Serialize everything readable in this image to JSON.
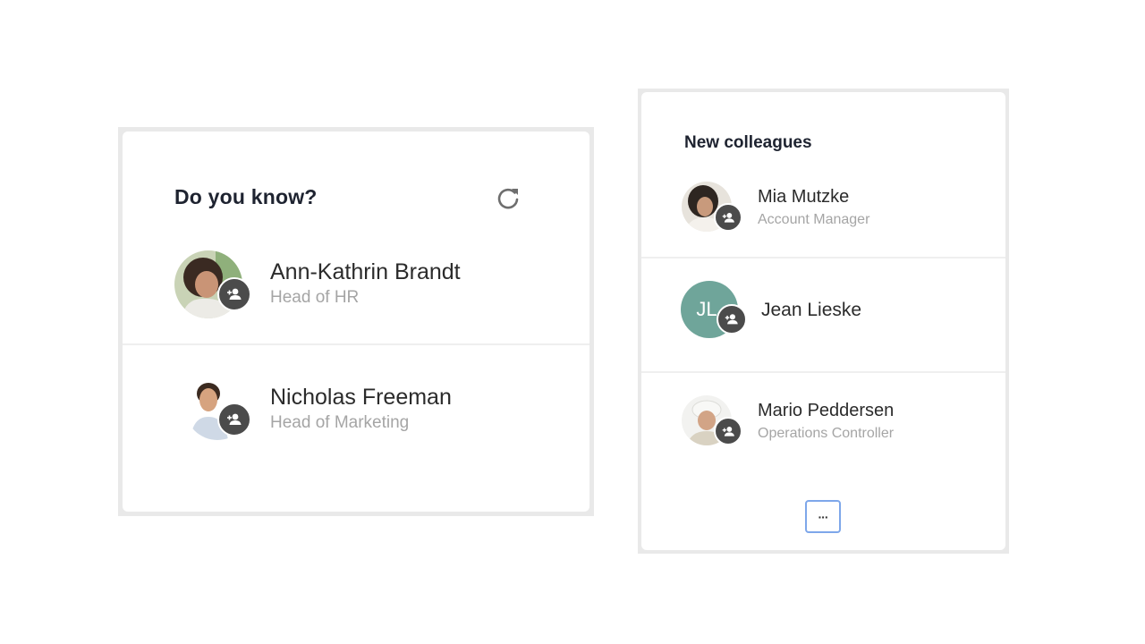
{
  "do_you_know": {
    "title": "Do you know?",
    "refresh_icon": "refresh-icon",
    "people": [
      {
        "name": "Ann-Kathrin Brandt",
        "role": "Head of HR",
        "add_icon": "add-person-icon"
      },
      {
        "name": "Nicholas Freeman",
        "role": "Head of Marketing",
        "add_icon": "add-person-icon"
      }
    ]
  },
  "new_colleagues": {
    "title": "New colleagues",
    "people": [
      {
        "name": "Mia Mutzke",
        "role": "Account Manager"
      },
      {
        "name": "Jean Lieske",
        "initials": "JL",
        "avatar_color": "#6fa59a"
      },
      {
        "name": "Mario Peddersen",
        "role": "Operations Controller"
      }
    ],
    "more_label": "···"
  },
  "colors": {
    "title": "#1e2330",
    "role": "#a5a5a5",
    "badge": "#4b4b4b",
    "focus": "#7ea7ea"
  }
}
